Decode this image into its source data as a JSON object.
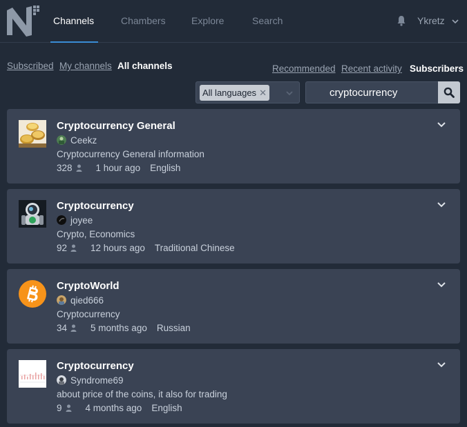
{
  "nav": {
    "tabs": [
      {
        "label": "Channels"
      },
      {
        "label": "Chambers"
      },
      {
        "label": "Explore"
      },
      {
        "label": "Search"
      }
    ],
    "user_name": "Ykretz"
  },
  "filters": {
    "subscribed": "Subscribed",
    "my_channels": "My channels",
    "all_channels": "All channels"
  },
  "sort": {
    "recommended": "Recommended",
    "recent_activity": "Recent activity",
    "subscribers": "Subscribers"
  },
  "language_filter": {
    "selected": "All languages"
  },
  "search": {
    "value": "cryptocurrency"
  },
  "channels": [
    {
      "title": "Cryptocurrency General",
      "owner": "Ceekz",
      "description": "Cryptocurrency General information",
      "subscribers": "328",
      "last_activity": "1 hour ago",
      "language": "English"
    },
    {
      "title": "Cryptocurrency",
      "owner": "joyee",
      "description": "Crypto, Economics",
      "subscribers": "92",
      "last_activity": "12 hours ago",
      "language": "Traditional Chinese"
    },
    {
      "title": "CryptoWorld",
      "owner": "qied666",
      "description": "Cryptocurrency",
      "subscribers": "34",
      "last_activity": "5 months ago",
      "language": "Russian"
    },
    {
      "title": "Cryptocurrency",
      "owner": "Syndrome69",
      "description": "about price of the coins, it also for trading",
      "subscribers": "9",
      "last_activity": "4 months ago",
      "language": "English"
    }
  ],
  "colors": {
    "background": "#222b38",
    "card": "#3a4354",
    "accent": "#3a8dd6",
    "bitcoin_orange": "#f7931a"
  },
  "icons": {
    "bell": "bell-icon",
    "chevron": "chevron-down-icon",
    "search": "search-icon",
    "person": "person-icon",
    "remove": "close-icon"
  }
}
